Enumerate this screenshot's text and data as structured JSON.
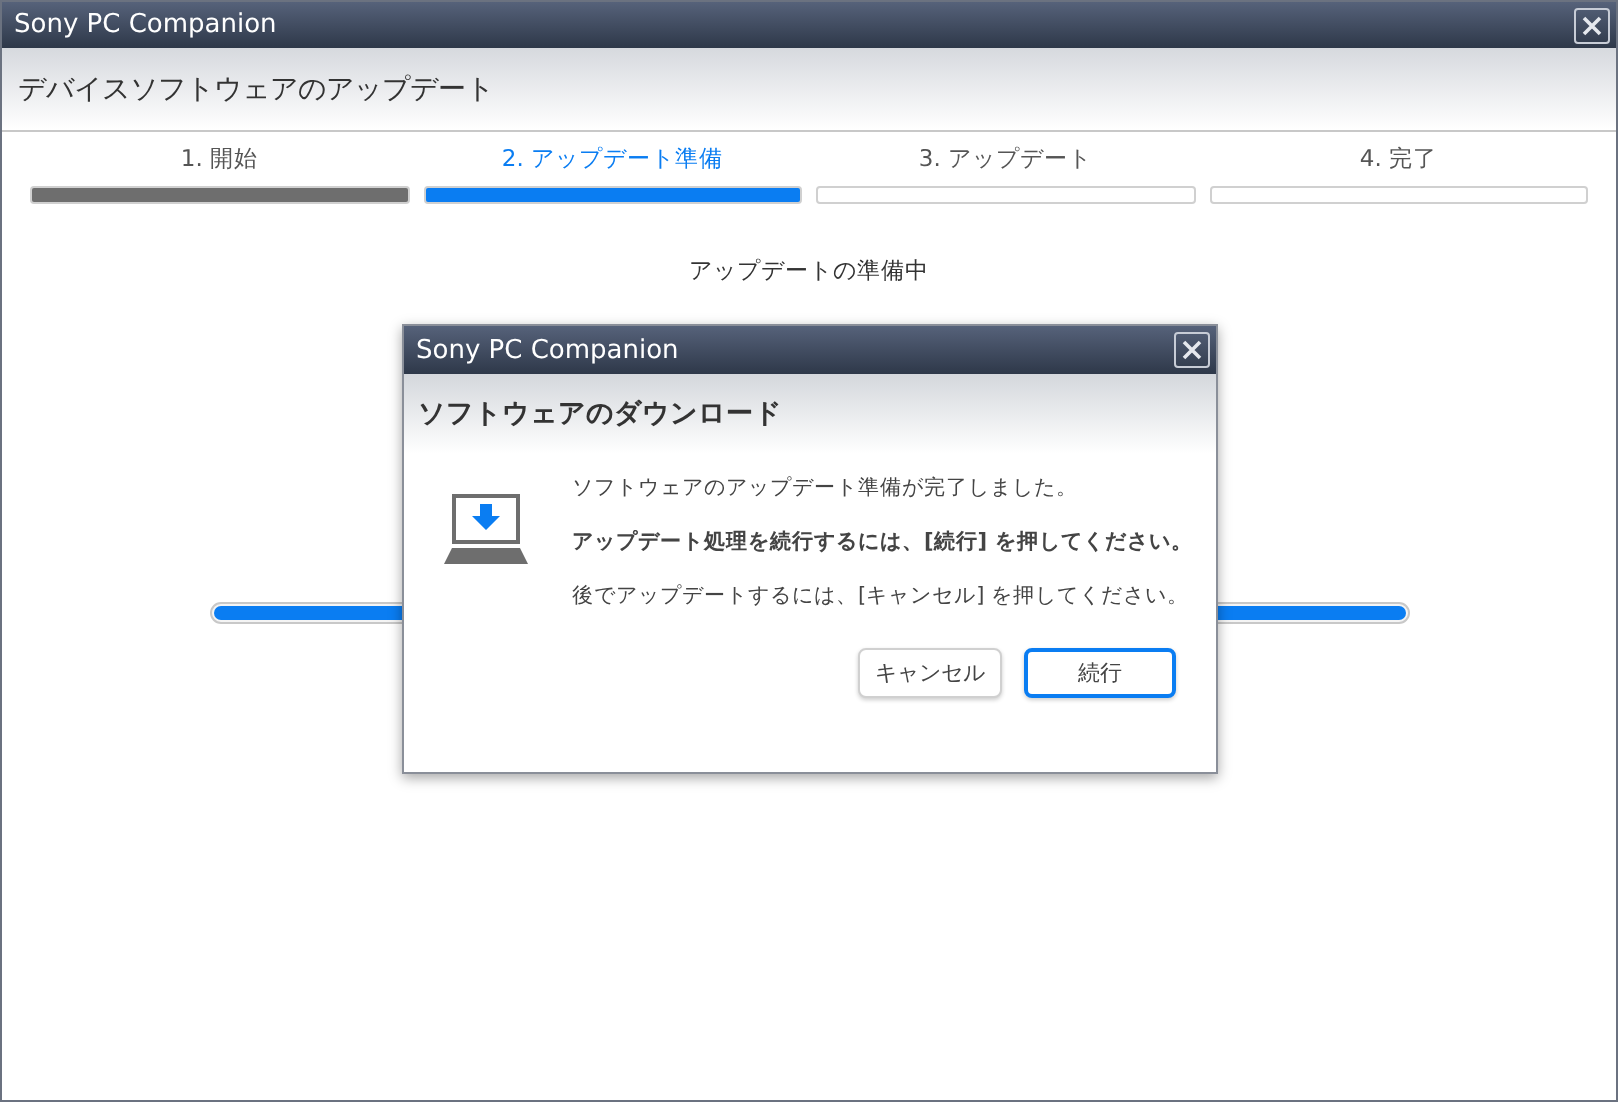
{
  "window": {
    "title": "Sony PC Companion"
  },
  "header": {
    "title": "デバイスソフトウェアのアップデート"
  },
  "steps": [
    {
      "label": "1. 開始",
      "kind": "done"
    },
    {
      "label": "2. アップデート準備",
      "kind": "current"
    },
    {
      "label": "3. アップデート",
      "kind": "pending"
    },
    {
      "label": "4. 完了",
      "kind": "pending"
    }
  ],
  "status": {
    "text": "アップデートの準備中",
    "level": 1
  },
  "dialog": {
    "title": "Sony PC Companion",
    "heading": "ソフトウェアのダウンロード",
    "messages": [
      {
        "text": "ソフトウェアのアップデート準備が完了しました。",
        "bold": false
      },
      {
        "text": "アップデート処理を続行するには、[続行] を押してください。",
        "bold": true
      },
      {
        "text": "後でアップデートするには、[キャンセル] を押してください。",
        "bold": false
      }
    ],
    "buttons": [
      {
        "label": "キャンセル",
        "primary": false
      },
      {
        "label": "続行",
        "primary": true
      }
    ]
  }
}
